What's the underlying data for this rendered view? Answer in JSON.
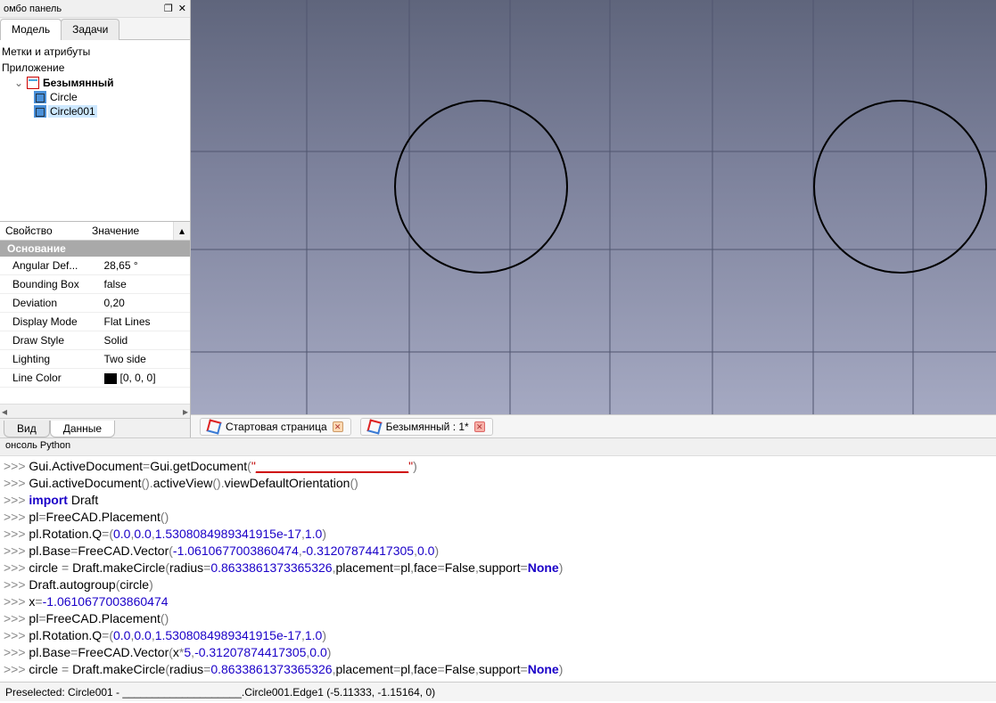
{
  "combo": {
    "title": "омбо панель",
    "tabs": {
      "model": "Модель",
      "tasks": "Задачи"
    },
    "labels_heading": "Метки и атрибуты",
    "app_heading": "Приложение",
    "doc_name": "Безымянный",
    "items": [
      "Circle",
      "Circle001"
    ]
  },
  "props": {
    "col_prop": "Свойство",
    "col_val": "Значение",
    "section": "Основание",
    "rows": [
      {
        "k": "Angular Def...",
        "v": "28,65 °"
      },
      {
        "k": "Bounding Box",
        "v": "false"
      },
      {
        "k": "Deviation",
        "v": "0,20"
      },
      {
        "k": "Display Mode",
        "v": "Flat Lines"
      },
      {
        "k": "Draw Style",
        "v": "Solid"
      },
      {
        "k": "Lighting",
        "v": "Two side"
      },
      {
        "k": "Line Color",
        "v": "[0, 0, 0]",
        "swatch": true
      }
    ],
    "bottom_tabs": {
      "view": "Вид",
      "data": "Данные"
    }
  },
  "doc_tabs": {
    "start": "Стартовая страница",
    "doc": "Безымянный : 1*"
  },
  "python": {
    "title": "онсоль Python",
    "lines": [
      {
        "t": "cmd",
        "segs": [
          {
            "c": "",
            "t": "Gui.ActiveDocument"
          },
          {
            "c": "pun",
            "t": "="
          },
          {
            "c": "",
            "t": "Gui.getDocument"
          },
          {
            "c": "pun",
            "t": "("
          },
          {
            "c": "str",
            "t": "\""
          },
          {
            "c": "redblank",
            "t": "______________________"
          },
          {
            "c": "str",
            "t": "\""
          },
          {
            "c": "pun",
            "t": ")"
          }
        ]
      },
      {
        "t": "cmd",
        "segs": [
          {
            "c": "",
            "t": "Gui.activeDocument"
          },
          {
            "c": "pun",
            "t": "()."
          },
          {
            "c": "",
            "t": "activeView"
          },
          {
            "c": "pun",
            "t": "()."
          },
          {
            "c": "",
            "t": "viewDefaultOrientation"
          },
          {
            "c": "pun",
            "t": "()"
          }
        ]
      },
      {
        "t": "cmd",
        "segs": [
          {
            "c": "kw",
            "t": "import"
          },
          {
            "c": "",
            "t": " Draft"
          }
        ]
      },
      {
        "t": "cmd",
        "segs": [
          {
            "c": "",
            "t": "pl"
          },
          {
            "c": "pun",
            "t": "="
          },
          {
            "c": "",
            "t": "FreeCAD.Placement"
          },
          {
            "c": "pun",
            "t": "()"
          }
        ]
      },
      {
        "t": "cmd",
        "segs": [
          {
            "c": "",
            "t": "pl.Rotation.Q"
          },
          {
            "c": "pun",
            "t": "=("
          },
          {
            "c": "num",
            "t": "0.0"
          },
          {
            "c": "pun",
            "t": ","
          },
          {
            "c": "num",
            "t": "0.0"
          },
          {
            "c": "pun",
            "t": ","
          },
          {
            "c": "num",
            "t": "1.5308084989341915e-17"
          },
          {
            "c": "pun",
            "t": ","
          },
          {
            "c": "num",
            "t": "1.0"
          },
          {
            "c": "pun",
            "t": ")"
          }
        ]
      },
      {
        "t": "cmd",
        "segs": [
          {
            "c": "",
            "t": "pl.Base"
          },
          {
            "c": "pun",
            "t": "="
          },
          {
            "c": "",
            "t": "FreeCAD.Vector"
          },
          {
            "c": "pun",
            "t": "("
          },
          {
            "c": "num",
            "t": "-1.0610677003860474"
          },
          {
            "c": "pun",
            "t": ","
          },
          {
            "c": "num",
            "t": "-0.31207874417305"
          },
          {
            "c": "pun",
            "t": ","
          },
          {
            "c": "num",
            "t": "0.0"
          },
          {
            "c": "pun",
            "t": ")"
          }
        ]
      },
      {
        "t": "cmd",
        "segs": [
          {
            "c": "",
            "t": "circle "
          },
          {
            "c": "pun",
            "t": "= "
          },
          {
            "c": "",
            "t": "Draft.makeCircle"
          },
          {
            "c": "pun",
            "t": "("
          },
          {
            "c": "",
            "t": "radius"
          },
          {
            "c": "pun",
            "t": "="
          },
          {
            "c": "num",
            "t": "0.8633861373365326"
          },
          {
            "c": "pun",
            "t": ","
          },
          {
            "c": "",
            "t": "placement"
          },
          {
            "c": "pun",
            "t": "="
          },
          {
            "c": "",
            "t": "pl"
          },
          {
            "c": "pun",
            "t": ","
          },
          {
            "c": "",
            "t": "face"
          },
          {
            "c": "pun",
            "t": "="
          },
          {
            "c": "",
            "t": "False"
          },
          {
            "c": "pun",
            "t": ","
          },
          {
            "c": "",
            "t": "support"
          },
          {
            "c": "pun",
            "t": "="
          },
          {
            "c": "kw",
            "t": "None"
          },
          {
            "c": "pun",
            "t": ")"
          }
        ]
      },
      {
        "t": "cmd",
        "segs": [
          {
            "c": "",
            "t": "Draft.autogroup"
          },
          {
            "c": "pun",
            "t": "("
          },
          {
            "c": "",
            "t": "circle"
          },
          {
            "c": "pun",
            "t": ")"
          }
        ]
      },
      {
        "t": "cmd",
        "segs": [
          {
            "c": "",
            "t": "x"
          },
          {
            "c": "pun",
            "t": "="
          },
          {
            "c": "num",
            "t": "-1.0610677003860474"
          }
        ]
      },
      {
        "t": "cmd",
        "segs": [
          {
            "c": "",
            "t": "pl"
          },
          {
            "c": "pun",
            "t": "="
          },
          {
            "c": "",
            "t": "FreeCAD.Placement"
          },
          {
            "c": "pun",
            "t": "()"
          }
        ]
      },
      {
        "t": "cmd",
        "segs": [
          {
            "c": "",
            "t": "pl.Rotation.Q"
          },
          {
            "c": "pun",
            "t": "=("
          },
          {
            "c": "num",
            "t": "0.0"
          },
          {
            "c": "pun",
            "t": ","
          },
          {
            "c": "num",
            "t": "0.0"
          },
          {
            "c": "pun",
            "t": ","
          },
          {
            "c": "num",
            "t": "1.5308084989341915e-17"
          },
          {
            "c": "pun",
            "t": ","
          },
          {
            "c": "num",
            "t": "1.0"
          },
          {
            "c": "pun",
            "t": ")"
          }
        ]
      },
      {
        "t": "cmd",
        "segs": [
          {
            "c": "",
            "t": "pl.Base"
          },
          {
            "c": "pun",
            "t": "="
          },
          {
            "c": "",
            "t": "FreeCAD.Vector"
          },
          {
            "c": "pun",
            "t": "("
          },
          {
            "c": "",
            "t": "x"
          },
          {
            "c": "pun",
            "t": "*"
          },
          {
            "c": "num",
            "t": "5"
          },
          {
            "c": "pun",
            "t": ","
          },
          {
            "c": "num",
            "t": "-0.31207874417305"
          },
          {
            "c": "pun",
            "t": ","
          },
          {
            "c": "num",
            "t": "0.0"
          },
          {
            "c": "pun",
            "t": ")"
          }
        ]
      },
      {
        "t": "cmd",
        "segs": [
          {
            "c": "",
            "t": "circle "
          },
          {
            "c": "pun",
            "t": "= "
          },
          {
            "c": "",
            "t": "Draft.makeCircle"
          },
          {
            "c": "pun",
            "t": "("
          },
          {
            "c": "",
            "t": "radius"
          },
          {
            "c": "pun",
            "t": "="
          },
          {
            "c": "num",
            "t": "0.8633861373365326"
          },
          {
            "c": "pun",
            "t": ","
          },
          {
            "c": "",
            "t": "placement"
          },
          {
            "c": "pun",
            "t": "="
          },
          {
            "c": "",
            "t": "pl"
          },
          {
            "c": "pun",
            "t": ","
          },
          {
            "c": "",
            "t": "face"
          },
          {
            "c": "pun",
            "t": "="
          },
          {
            "c": "",
            "t": "False"
          },
          {
            "c": "pun",
            "t": ","
          },
          {
            "c": "",
            "t": "support"
          },
          {
            "c": "pun",
            "t": "="
          },
          {
            "c": "kw",
            "t": "None"
          },
          {
            "c": "pun",
            "t": ")"
          }
        ]
      },
      {
        "t": "cmd",
        "segs": [
          {
            "c": "",
            "t": ""
          }
        ]
      }
    ]
  },
  "status": {
    "text": "Preselected: Circle001 - ____________________.Circle001.Edge1 (-5.11333, -1.15164, 0)"
  }
}
